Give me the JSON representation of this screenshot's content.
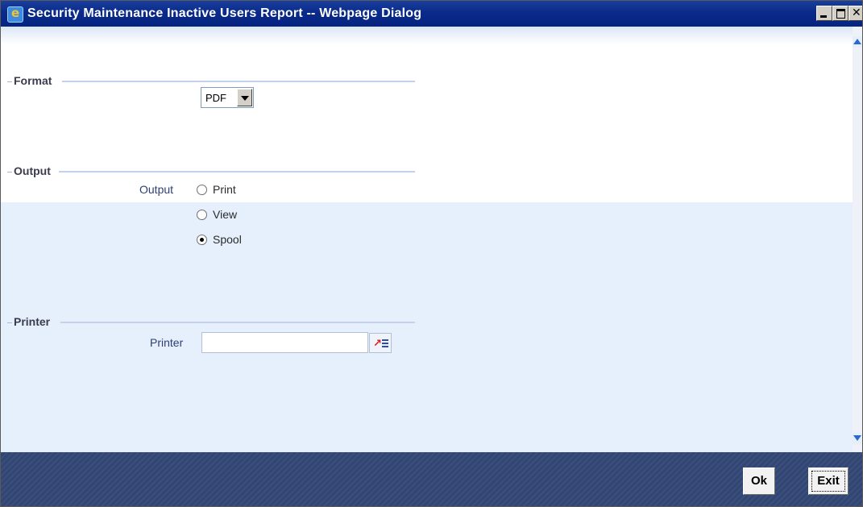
{
  "window": {
    "title": "Security Maintenance Inactive Users Report -- Webpage Dialog",
    "controls": [
      "minimize-icon",
      "maximize-icon",
      "close-icon"
    ]
  },
  "format": {
    "section_title": "Format",
    "selected": "PDF"
  },
  "output": {
    "section_title": "Output",
    "field_label": "Output",
    "options": [
      {
        "label": "Print",
        "checked": false
      },
      {
        "label": "View",
        "checked": false
      },
      {
        "label": "Spool",
        "checked": true
      }
    ]
  },
  "printer": {
    "section_title": "Printer",
    "field_label": "Printer",
    "value": ""
  },
  "footer": {
    "ok_label": "Ok",
    "exit_label": "Exit"
  },
  "colors": {
    "titlebar": "#0a2a8a",
    "footer": "#344a78",
    "label": "#2e3e72",
    "panel": "#e5f0fc"
  }
}
